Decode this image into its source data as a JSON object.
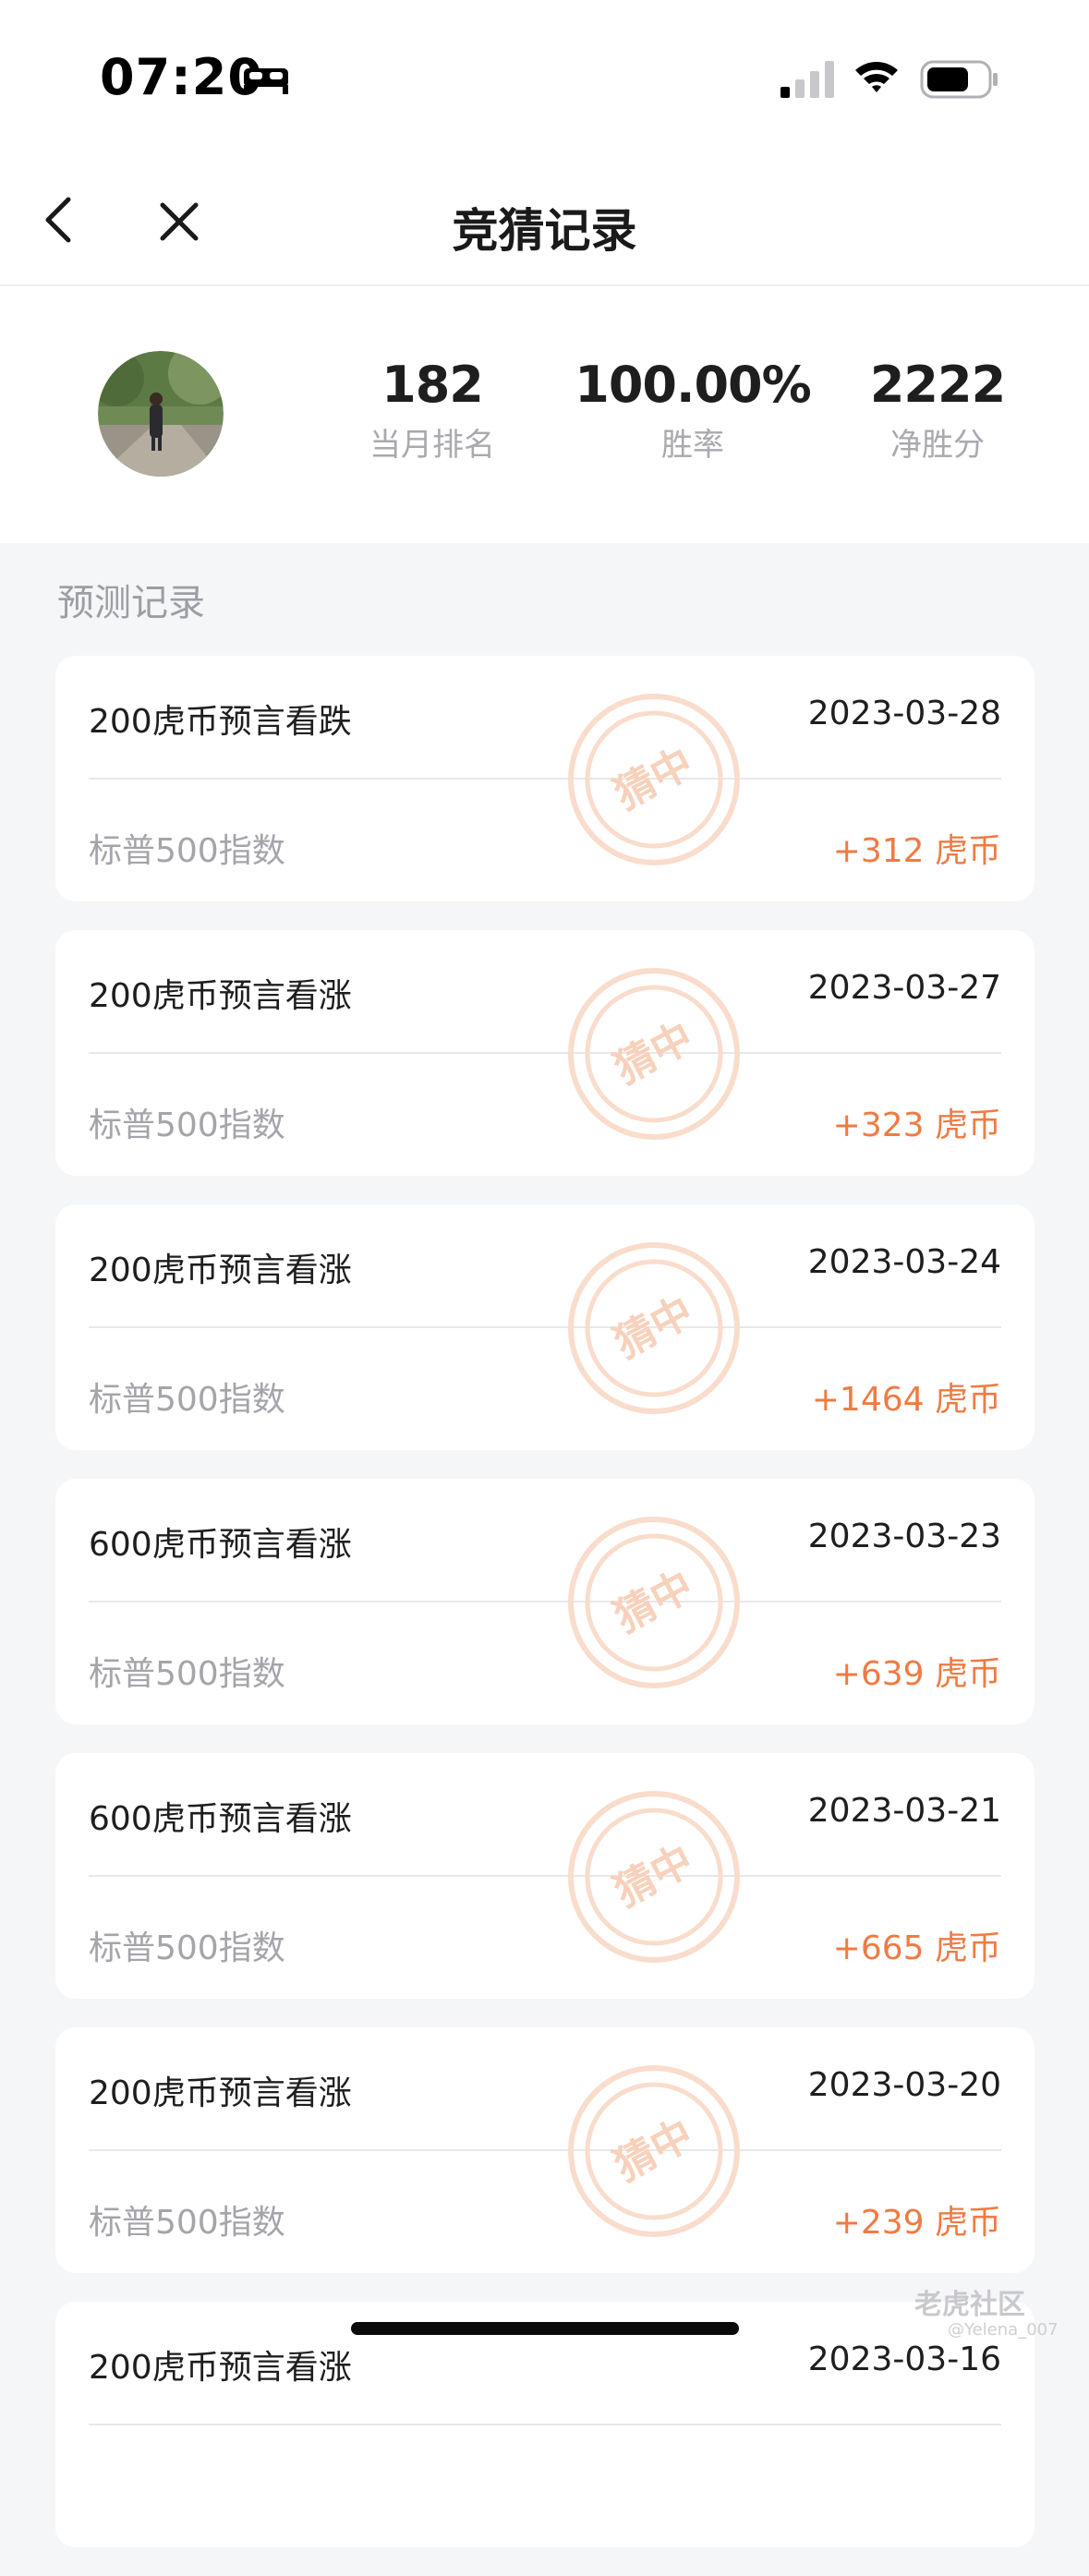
{
  "status_bar": {
    "time": "07:20"
  },
  "nav": {
    "title": "竞猜记录"
  },
  "profile": {
    "stats": [
      {
        "value": "182",
        "label": "当月排名"
      },
      {
        "value": "100.00%",
        "label": "胜率"
      },
      {
        "value": "2222",
        "label": "净胜分"
      }
    ]
  },
  "section": {
    "heading": "预测记录"
  },
  "stamp_text": "猜中",
  "records": [
    {
      "title": "200虎币预言看跌",
      "date": "2023-03-28",
      "index": "标普500指数",
      "reward": "+312 虎币"
    },
    {
      "title": "200虎币预言看涨",
      "date": "2023-03-27",
      "index": "标普500指数",
      "reward": "+323 虎币"
    },
    {
      "title": "200虎币预言看涨",
      "date": "2023-03-24",
      "index": "标普500指数",
      "reward": "+1464 虎币"
    },
    {
      "title": "600虎币预言看涨",
      "date": "2023-03-23",
      "index": "标普500指数",
      "reward": "+639 虎币"
    },
    {
      "title": "600虎币预言看涨",
      "date": "2023-03-21",
      "index": "标普500指数",
      "reward": "+665 虎币"
    },
    {
      "title": "200虎币预言看涨",
      "date": "2023-03-20",
      "index": "标普500指数",
      "reward": "+239 虎币"
    },
    {
      "title": "200虎币预言看涨",
      "date": "2023-03-16",
      "index": "",
      "reward": ""
    }
  ],
  "watermark": {
    "brand": "老虎社区",
    "user": "@Yelena_007"
  },
  "colors": {
    "accent": "#ef7b43",
    "stamp": "#f7d1bb",
    "background": "#f5f6f8"
  }
}
